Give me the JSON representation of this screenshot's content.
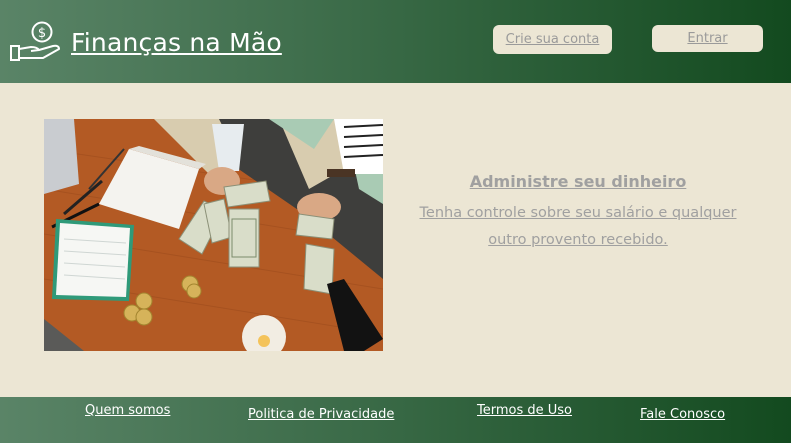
{
  "header": {
    "brand": "Finanças na Mão",
    "logo_icon": "hand-money-icon",
    "signup_label": "Crie sua conta",
    "login_label": "Entrar"
  },
  "hero": {
    "title": "Administre seu dinheiro",
    "text": "Tenha controle sobre seu salário e qualquer outro provento recebido."
  },
  "footer": {
    "links": [
      "Quem somos",
      "Politica de Privacidade",
      "Termos de Uso",
      "Fale Conosco"
    ]
  },
  "colors": {
    "header_gradient_start": "#5a8467",
    "header_gradient_end": "#134a1f",
    "background": "#ece6d4",
    "muted_text": "#a0a0a0"
  }
}
